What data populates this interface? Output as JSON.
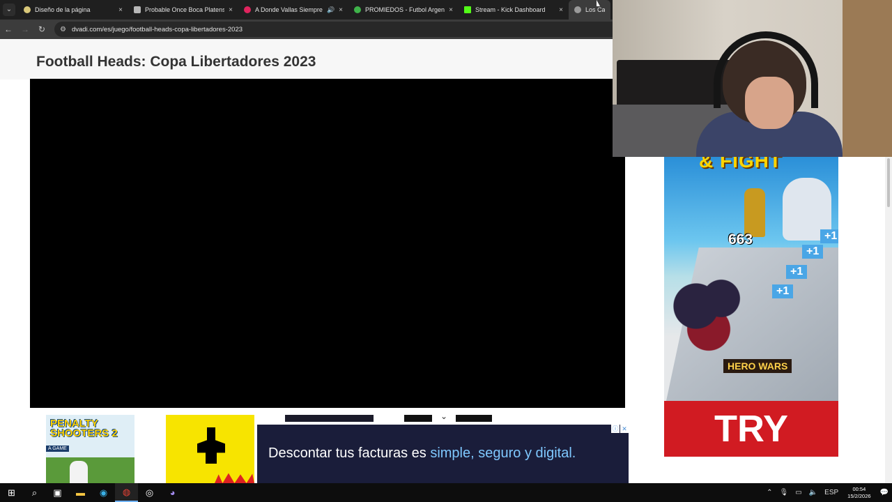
{
  "browser": {
    "tabs": [
      {
        "title": "Diseño de la página",
        "color": "#d9c87a"
      },
      {
        "title": "Probable Once Boca Platense",
        "color": "#b7b7b7"
      },
      {
        "title": "A Donde Vallas Siempre Es...",
        "color": "#e0245e",
        "audio": "🔊"
      },
      {
        "title": "PROMIEDOS - Futbol Argentino",
        "color": "#3fb34a"
      },
      {
        "title": "Stream - Kick Dashboard",
        "color": "#53fc18"
      },
      {
        "title": "Los Cabezo",
        "color": "#9a9a9a"
      }
    ],
    "close_glyph": "×",
    "url": "dvadi.com/es/juego/football-heads-copa-libertadores-2023"
  },
  "page": {
    "title": "Football Heads: Copa Libertadores 2023",
    "thumbnails": [
      {
        "title_line1": "PENALTY",
        "title_line2": "SHOOTERS 2",
        "tag": "A GAME"
      }
    ],
    "chevron": "⌄"
  },
  "ads": {
    "banner": {
      "text_plain": "Descontar tus facturas es ",
      "text_highlight": "simple, seguro y digital."
    },
    "banner_badges": [
      "ⓘ",
      "✕"
    ],
    "sidebar": {
      "headline": "& FIGHT",
      "count": "663",
      "plus_labels": [
        "+1",
        "+1",
        "+1",
        "+1"
      ],
      "logo": "HERO WARS",
      "cta": "TRY"
    }
  },
  "taskbar": {
    "language": "ESP",
    "time": "00:54",
    "date": "15/2/2026"
  }
}
